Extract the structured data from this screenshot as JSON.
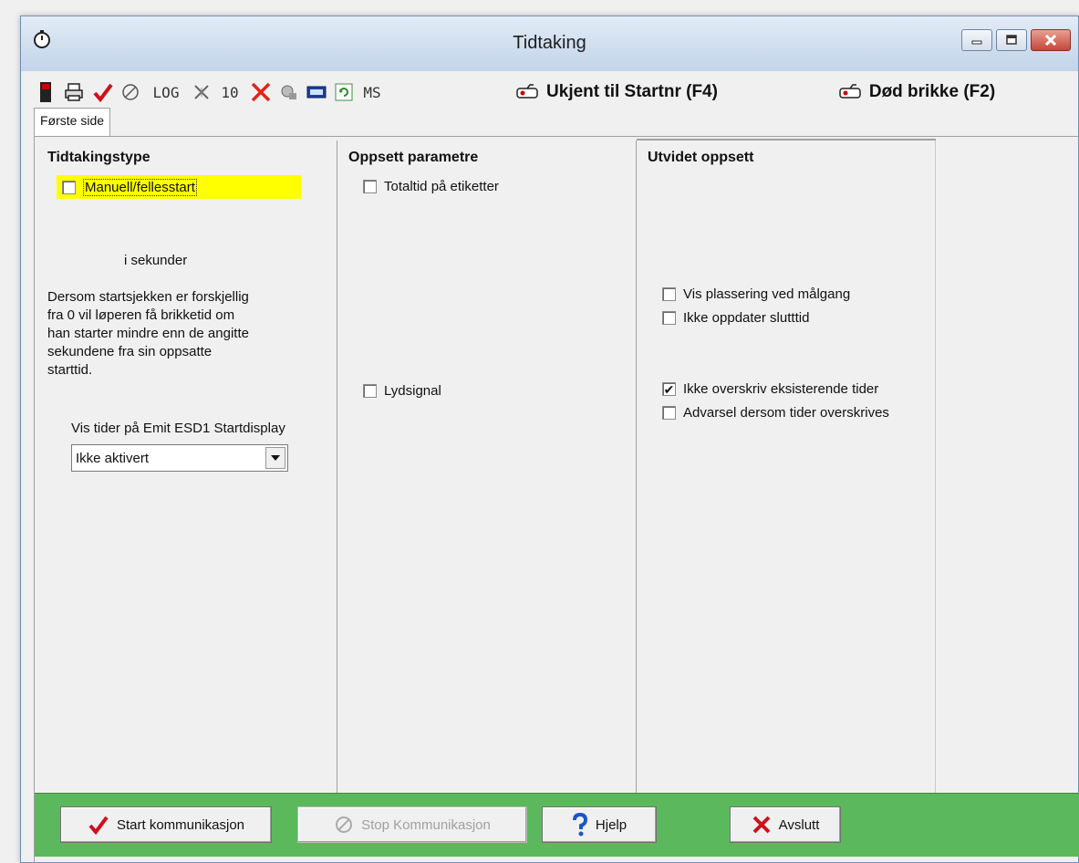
{
  "window": {
    "title": "Tidtaking"
  },
  "toolbar": {
    "log_label": "LOG",
    "ten_label": "10",
    "ms_label": "MS",
    "ukjent_label": "Ukjent til Startnr (F4)",
    "dod_label": "Død brikke (F2)"
  },
  "tab": {
    "label": "Første side"
  },
  "col1": {
    "heading": "Tidtakingstype",
    "manuell_label": "Manuell/fellesstart",
    "sekunder_label": "i sekunder",
    "description_lines": [
      "Dersom startsjekken er  forskjellig",
      "fra 0 vil løperen få brikketid om",
      "han starter mindre enn de angitte",
      "sekundene fra sin oppsatte",
      "starttid."
    ],
    "display_label": "Vis tider på Emit ESD1 Startdisplay",
    "display_value": "Ikke aktivert"
  },
  "col2": {
    "heading": "Oppsett parametre",
    "totaltid_label": "Totaltid på etiketter",
    "lydsignal_label": "Lydsignal"
  },
  "col3": {
    "heading": "Utvidet oppsett",
    "vis_plassering_label": "Vis plassering ved målgang",
    "ikke_oppdater_label": "Ikke oppdater slutttid",
    "ikke_overskriv_label": "Ikke overskriv eksisterende tider",
    "advarsel_label": "Advarsel dersom tider overskrives"
  },
  "bottom": {
    "start_label": "Start kommunikasjon",
    "stop_label": "Stop Kommunikasjon",
    "hjelp_label": "Hjelp",
    "avslutt_label": "Avslutt"
  }
}
